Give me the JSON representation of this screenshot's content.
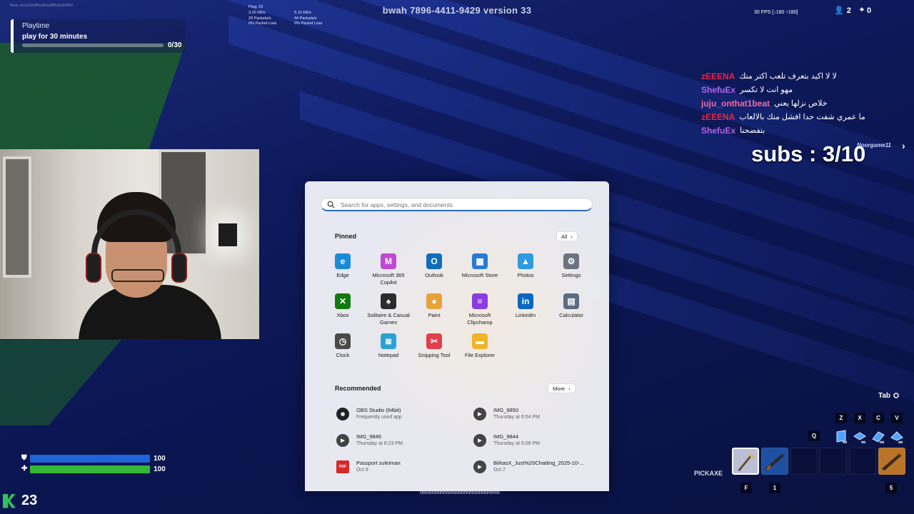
{
  "hud": {
    "top_title": "bwah   7896-4411-9429 version 33",
    "fps_text": "30 FPS [↓180 ↑180]",
    "players_count": "2",
    "eliminations": "0",
    "top_id": "Bbax   aa1a2b8a8f0a4b0a9f95a0d04904",
    "net": {
      "ping": "Ping: 23",
      "down_rate": "3.20 KB/s",
      "down_packets": "29 Packets/s",
      "down_loss": "0% Packet Loss",
      "up_rate": "5.10 KB/s",
      "up_packets": "44 Packets/s",
      "up_loss": "0% Packet Loss"
    },
    "health": "100",
    "shield": "100",
    "materials": "23",
    "tab_label": "Tab",
    "pickaxe_label": "PICKAXE",
    "slot_keys": [
      "F",
      "1",
      "5"
    ],
    "build_keys": [
      "Z",
      "X",
      "C",
      "V"
    ],
    "q_key": "Q",
    "infinity": "∞",
    "health_progress": 1.0,
    "shield_progress": 1.0,
    "colors": {
      "shield": "#1e63d8",
      "health": "#35b83a",
      "materials": "#2ec45c"
    }
  },
  "quest": {
    "heading": "Playtime",
    "task": "play for 30 minutes",
    "progress_text": "0/30",
    "progress": 0
  },
  "chat": [
    {
      "name": "zEEENA",
      "color": "#e0284a",
      "msg": "لا لا اكيد بتعرف تلعب اكتر منك"
    },
    {
      "name": "ShefuEx",
      "color": "#b163e8",
      "msg": "مهو انت لا تكسر"
    },
    {
      "name": "juju_onthat1beat",
      "color": "#f06aa0",
      "msg": "خلاص نزلها يعني"
    },
    {
      "name": "zEEENA",
      "color": "#e0284a",
      "msg": "ما عمري شفت حدا افشل منك بالالعاب"
    },
    {
      "name": "ShefuEx",
      "color": "#b163e8",
      "msg": "بتفضحنا"
    }
  ],
  "subs": {
    "text": "subs : 3/10",
    "user": "Noorgame11",
    "arrow": "›"
  },
  "start_menu": {
    "search_placeholder": "Search for apps, settings, and documents",
    "pinned_title": "Pinned",
    "all_label": "All",
    "recommended_title": "Recommended",
    "more_label": "More",
    "pinned": [
      {
        "label": "Edge",
        "icon": "edge-icon",
        "color": "#1b8ad8",
        "glyph": "e"
      },
      {
        "label": "Microsoft 365 Copilot",
        "icon": "copilot-icon",
        "color": "#c048d8",
        "glyph": "M"
      },
      {
        "label": "Outlook",
        "icon": "outlook-icon",
        "color": "#0f6cbd",
        "glyph": "O"
      },
      {
        "label": "Microsoft Store",
        "icon": "store-icon",
        "color": "#2a7ad4",
        "glyph": "▦"
      },
      {
        "label": "Photos",
        "icon": "photos-icon",
        "color": "#2e9be0",
        "glyph": "▲"
      },
      {
        "label": "Settings",
        "icon": "settings-icon",
        "color": "#6b7280",
        "glyph": "⚙"
      },
      {
        "label": "Xbox",
        "icon": "xbox-icon",
        "color": "#107c10",
        "glyph": "✕"
      },
      {
        "label": "Solitaire & Casual Games",
        "icon": "solitaire-icon",
        "color": "#2c2c2c",
        "glyph": "♠"
      },
      {
        "label": "Paint",
        "icon": "paint-icon",
        "color": "#e8a23a",
        "glyph": "●"
      },
      {
        "label": "Microsoft Clipchamp",
        "icon": "clipchamp-icon",
        "color": "#8a3ee0",
        "glyph": "≡"
      },
      {
        "label": "LinkedIn",
        "icon": "linkedin-icon",
        "color": "#0a66c2",
        "glyph": "in"
      },
      {
        "label": "Calculator",
        "icon": "calculator-icon",
        "color": "#5b6b80",
        "glyph": "▤"
      },
      {
        "label": "Clock",
        "icon": "clock-icon",
        "color": "#4a4a4a",
        "glyph": "◷"
      },
      {
        "label": "Notepad",
        "icon": "notepad-icon",
        "color": "#2ba2d6",
        "glyph": "≣"
      },
      {
        "label": "Snipping Tool",
        "icon": "snipping-tool-icon",
        "color": "#e0404a",
        "glyph": "✂"
      },
      {
        "label": "File Explorer",
        "icon": "file-explorer-icon",
        "color": "#f0b429",
        "glyph": "▬"
      }
    ],
    "recommended": [
      {
        "name": "OBS Studio (64bit)",
        "sub": "Frequently used app",
        "icon": "obs-icon"
      },
      {
        "name": "IMG_9850",
        "sub": "Thursday at 6:54 PM",
        "icon": "video-file-icon"
      },
      {
        "name": "IMG_9846",
        "sub": "Thursday at 6:23 PM",
        "icon": "video-file-icon"
      },
      {
        "name": "IMG_9844",
        "sub": "Thursday at 6:09 PM",
        "icon": "video-file-icon"
      },
      {
        "name": "Passport suleiman",
        "sub": "Oct 9",
        "icon": "pdf-icon"
      },
      {
        "name": "BiihasX_Just%20Chatting_2025-10-...",
        "sub": "Oct 7",
        "icon": "video-file-icon"
      }
    ]
  },
  "taskbar_hint": "NNNNNNNNNNNNNNNNNNNNNNNNNNN"
}
